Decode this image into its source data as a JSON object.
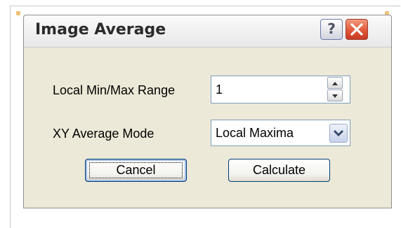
{
  "window": {
    "title": "Image Average",
    "help_label": "?",
    "help_icon": "help-icon",
    "close_icon": "close-icon"
  },
  "form": {
    "range_label": "Local Min/Max Range",
    "range_value": "1",
    "mode_label": "XY Average Mode",
    "mode_value": "Local Maxima"
  },
  "buttons": {
    "cancel": "Cancel",
    "calculate": "Calculate"
  },
  "colors": {
    "dialog_bg": "#ece9d8",
    "close_button": "#e2583b",
    "input_border": "#7f9db9"
  }
}
